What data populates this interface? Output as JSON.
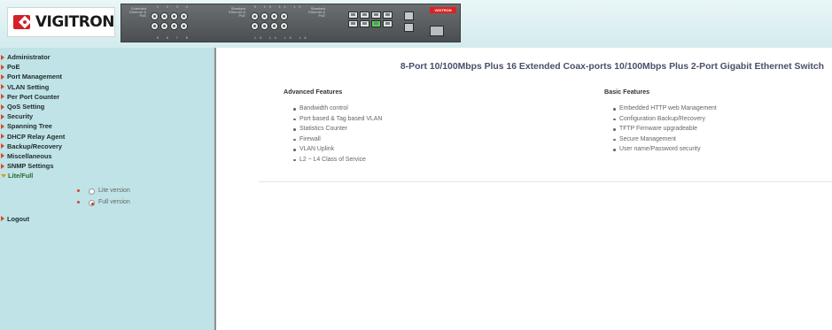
{
  "header": {
    "logo_text": "VIGITRON",
    "panel": {
      "group1_label": "Extended Ethernet & PoE",
      "group1_top_nums": "1 2 3 4",
      "group1_bottom_nums": "5 6 7 8",
      "group2_label": "Standard Ethernet & PoE",
      "group2_top_nums": "9 10 11 12",
      "group2_bottom_nums": "13 14 15 16",
      "group3_label": "Standard Ethernet & PoE",
      "brand": "VIGITRON",
      "console_label": "Console"
    }
  },
  "sidebar": {
    "items": [
      {
        "label": "Administrator"
      },
      {
        "label": "PoE"
      },
      {
        "label": "Port Management"
      },
      {
        "label": "VLAN Setting"
      },
      {
        "label": "Per Port Counter"
      },
      {
        "label": "QoS Setting"
      },
      {
        "label": "Security"
      },
      {
        "label": "Spanning Tree"
      },
      {
        "label": "DHCP Relay Agent"
      },
      {
        "label": "Backup/Recovery"
      },
      {
        "label": "Miscellaneous"
      },
      {
        "label": "SNMP Settings"
      }
    ],
    "expanded": {
      "label": "Lite/Full"
    },
    "options": [
      {
        "label": "Lite version",
        "checked": false
      },
      {
        "label": "Full version",
        "checked": true
      }
    ],
    "logout": {
      "label": "Logout"
    }
  },
  "main": {
    "title": "8-Port 10/100Mbps Plus 16 Extended Coax-ports 10/100Mbps Plus 2-Port Gigabit Ethernet Switch",
    "advanced": {
      "heading": "Advanced Features",
      "items": [
        "Bandwidth control",
        "Port based & Tag based VLAN",
        "Statistics Counter",
        "Firewall",
        "VLAN Uplink",
        "L2 ~ L4 Class of Service"
      ]
    },
    "basic": {
      "heading": "Basic Features",
      "items": [
        "Embedded HTTP web Management",
        "Configuration Backup/Recovery",
        "TFTP Firmware upgradeable",
        "Secure Management",
        "User name/Password security"
      ]
    }
  },
  "colors": {
    "sidebar_bg": "#bfe3e6",
    "title_color": "#4a4f6a",
    "arrow_color": "#d04a2a",
    "link_port_color": "#4ed848"
  }
}
